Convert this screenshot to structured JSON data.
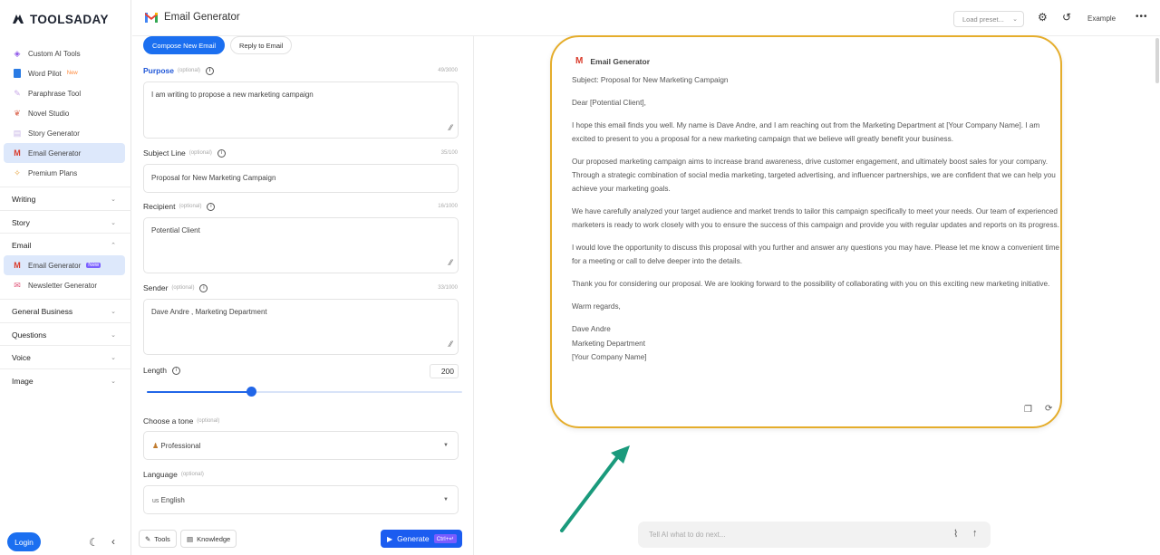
{
  "brand": {
    "name": "TOOLSADAY"
  },
  "sidebar": {
    "top_items": [
      {
        "label": "Custom AI Tools",
        "icon": "layers-icon",
        "badge": ""
      },
      {
        "label": "Word Pilot",
        "icon": "word-icon",
        "badge": "New"
      },
      {
        "label": "Paraphrase Tool",
        "icon": "paraphrase-icon",
        "badge": ""
      },
      {
        "label": "Novel Studio",
        "icon": "novel-icon",
        "badge": ""
      },
      {
        "label": "Story Generator",
        "icon": "story-icon",
        "badge": ""
      },
      {
        "label": "Email Generator",
        "icon": "gmail-icon",
        "badge": ""
      },
      {
        "label": "Premium Plans",
        "icon": "premium-icon",
        "badge": ""
      }
    ],
    "sections": [
      "Writing",
      "Story",
      "Email",
      "General Business",
      "Questions",
      "Voice",
      "Image"
    ],
    "email_items": [
      {
        "label": "Email Generator",
        "badge": "New"
      },
      {
        "label": "Newsletter Generator",
        "badge": ""
      }
    ],
    "login_label": "Login"
  },
  "topbar": {
    "title": "Email Generator",
    "load_preset": "Load preset...",
    "example_label": "Example"
  },
  "form": {
    "tabs": [
      "Compose New Email",
      "Reply to Email"
    ],
    "optional": "(optional)",
    "purpose": {
      "label": "Purpose",
      "count": "49/3000",
      "value": "I am writing to propose a new marketing campaign"
    },
    "subject": {
      "label": "Subject Line",
      "count": "35/100",
      "value": "Proposal for New Marketing Campaign"
    },
    "recipient": {
      "label": "Recipient",
      "count": "16/1000",
      "value": "Potential Client"
    },
    "sender": {
      "label": "Sender",
      "count": "33/1000",
      "value": "Dave Andre , Marketing Department"
    },
    "length": {
      "label": "Length",
      "value": "200",
      "fraction": 0.33
    },
    "tone": {
      "label": "Choose a tone",
      "value": "Professional"
    },
    "language": {
      "label": "Language",
      "value": "English",
      "flag": "us"
    },
    "tools_label": "Tools",
    "knowledge_label": "Knowledge",
    "generate_label": "Generate",
    "shortcut": "Ctrl+↵"
  },
  "result": {
    "title": "Email Generator",
    "subject_line": "Subject: Proposal for New Marketing Campaign",
    "greeting": "Dear [Potential Client],",
    "p1": "I hope this email finds you well. My name is Dave Andre, and I am reaching out from the Marketing Department at [Your Company Name]. I am excited to present to you a proposal for a new marketing campaign that we believe will greatly benefit your business.",
    "p2": "Our proposed marketing campaign aims to increase brand awareness, drive customer engagement, and ultimately boost sales for your company. Through a strategic combination of social media marketing, targeted advertising, and influencer partnerships, we are confident that we can help you achieve your marketing goals.",
    "p3": "We have carefully analyzed your target audience and market trends to tailor this campaign specifically to meet your needs. Our team of experienced marketers is ready to work closely with you to ensure the success of this campaign and provide you with regular updates and reports on its progress.",
    "p4": "I would love the opportunity to discuss this proposal with you further and answer any questions you may have. Please let me know a convenient time for a meeting or call to delve deeper into the details.",
    "p5": "Thank you for considering our proposal. We are looking forward to the possibility of collaborating with you on this exciting new marketing initiative.",
    "closing": "Warm regards,",
    "sig_name": "Dave Andre",
    "sig_dept": "Marketing Department",
    "sig_company": "[Your Company Name]"
  },
  "chat": {
    "placeholder": "Tell AI what to do next..."
  },
  "colors": {
    "accent": "#1b6ff0",
    "highlight_border": "#e5ad2b",
    "arrow": "#1a9a7c"
  }
}
